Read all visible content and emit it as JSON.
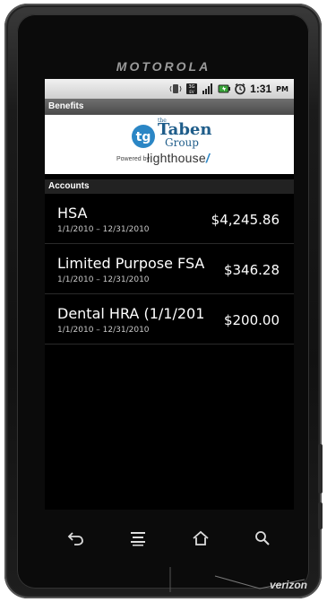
{
  "device": {
    "brand": "MOTOROLA",
    "carrier": "verizon"
  },
  "statusbar": {
    "time": "1:31",
    "ampm": "PM"
  },
  "titlebar": {
    "title": "Benefits"
  },
  "logo": {
    "the": "the",
    "name": "Taben",
    "sub": "Group",
    "powered_by": "Powered by",
    "powered_brand": "lighthouse"
  },
  "accounts": {
    "header": "Accounts",
    "items": [
      {
        "title": "HSA",
        "dates": "1/1/2010 – 12/31/2010",
        "amount": "$4,245.86"
      },
      {
        "title": "Limited Purpose FSA",
        "dates": "1/1/2010 – 12/31/2010",
        "amount": "$346.28"
      },
      {
        "title": "Dental HRA (1/1/201",
        "dates": "1/1/2010 – 12/31/2010",
        "amount": "$200.00"
      }
    ]
  },
  "navkeys": [
    "back-icon",
    "menu-icon",
    "home-icon",
    "search-icon"
  ],
  "colors": {
    "logo_blue": "#1f5d8a",
    "accent_swoosh": "#2b86c5",
    "titlebar_bg": "#5b5b5b",
    "section_bg": "#222222"
  }
}
